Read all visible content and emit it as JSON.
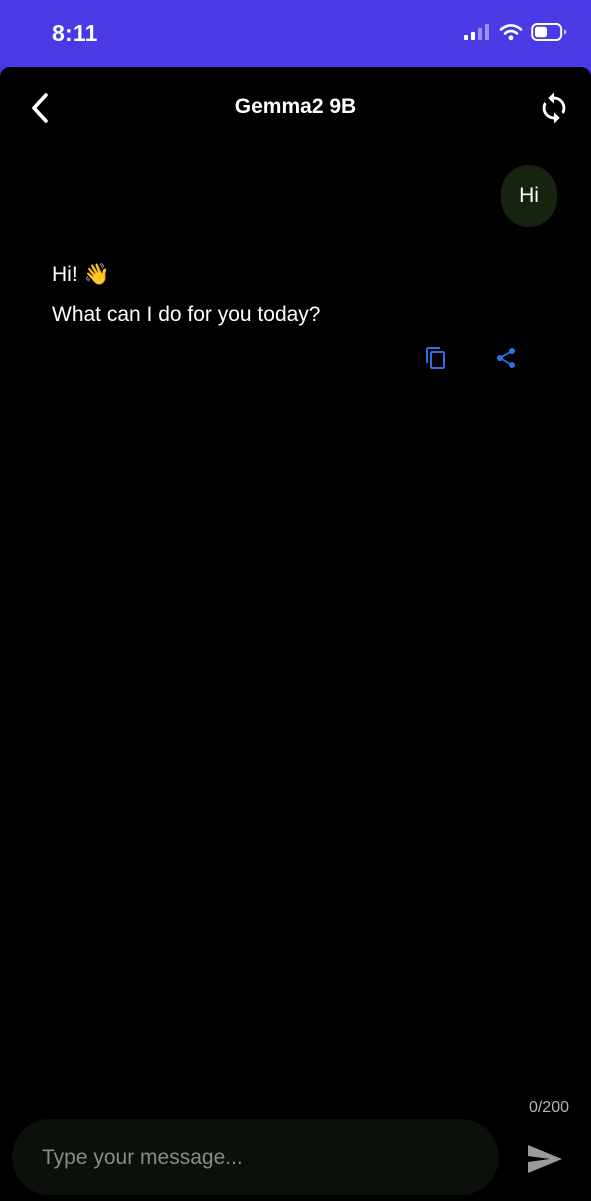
{
  "status_bar": {
    "time": "8:11",
    "icons": [
      "cellular-signal-icon",
      "wifi-icon",
      "battery-icon"
    ]
  },
  "header": {
    "title": "Gemma2 9B",
    "back_icon": "chevron-left-icon",
    "reset_icon": "refresh-icon"
  },
  "messages": [
    {
      "role": "user",
      "text": "Hi"
    },
    {
      "role": "assistant",
      "lines": [
        "Hi! 👋",
        "What can I do for you today?"
      ]
    }
  ],
  "message_actions": {
    "copy_icon": "copy-icon",
    "share_icon": "share-icon"
  },
  "composer": {
    "char_count": "0/200",
    "placeholder": "Type your message...",
    "value": "",
    "send_icon": "send-icon"
  },
  "colors": {
    "status_bar_bg": "#4a3ae6",
    "screen_bg": "#000000",
    "user_bubble_bg": "#16230f",
    "accent": "#2f6fe0",
    "input_bg": "#0b100a",
    "send_icon": "#9a9a9a"
  }
}
